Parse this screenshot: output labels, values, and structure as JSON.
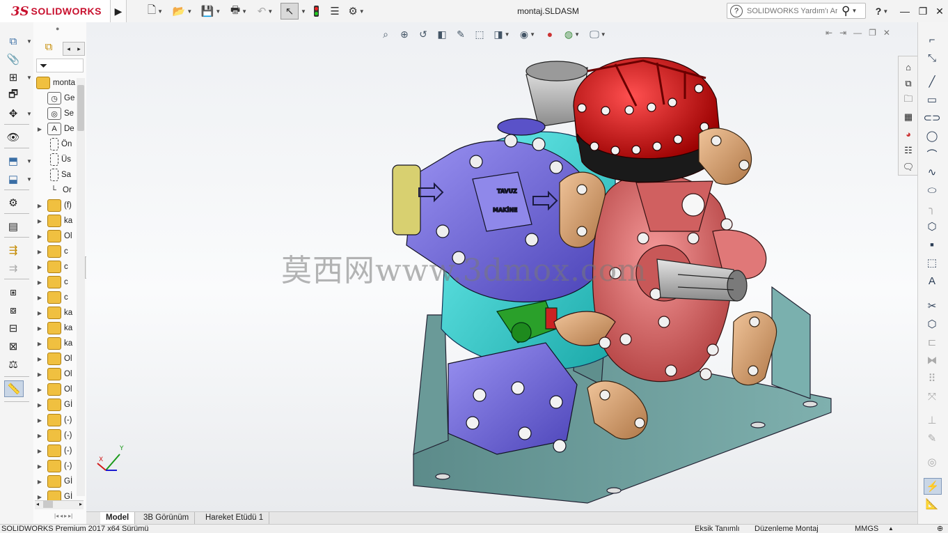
{
  "app": {
    "brand_ds": "3S",
    "brand_name": "SOLIDWORKS",
    "document_title": "montaj.SLDASM"
  },
  "help_search": {
    "placeholder": "SOLIDWORKS Yardım'ı Ara"
  },
  "feature_tree": {
    "root_label": "monta",
    "items": [
      {
        "label": "Ge",
        "icon": "history-icon",
        "expandable": false
      },
      {
        "label": "Se",
        "icon": "sensors-icon",
        "expandable": false
      },
      {
        "label": "De",
        "icon": "annotations-icon",
        "expandable": true
      },
      {
        "label": "Ön",
        "icon": "plane-icon",
        "expandable": false
      },
      {
        "label": "Üs",
        "icon": "plane-icon",
        "expandable": false
      },
      {
        "label": "Sa",
        "icon": "plane-icon",
        "expandable": false
      },
      {
        "label": "Or",
        "icon": "origin-icon",
        "expandable": false
      },
      {
        "label": "(f)",
        "icon": "part-icon",
        "expandable": true
      },
      {
        "label": "ka",
        "icon": "part-icon",
        "expandable": true
      },
      {
        "label": "Ol",
        "icon": "part-icon",
        "expandable": true
      },
      {
        "label": "c",
        "icon": "part-icon",
        "expandable": true
      },
      {
        "label": "c",
        "icon": "part-icon",
        "expandable": true
      },
      {
        "label": "c",
        "icon": "part-icon",
        "expandable": true
      },
      {
        "label": "c",
        "icon": "part-icon",
        "expandable": true
      },
      {
        "label": "ka",
        "icon": "part-icon",
        "expandable": true
      },
      {
        "label": "ka",
        "icon": "part-icon",
        "expandable": true
      },
      {
        "label": "ka",
        "icon": "part-icon",
        "expandable": true
      },
      {
        "label": "Ol",
        "icon": "part-icon",
        "expandable": true
      },
      {
        "label": "Ol",
        "icon": "part-icon",
        "expandable": true
      },
      {
        "label": "Ol",
        "icon": "part-icon",
        "expandable": true
      },
      {
        "label": "Gİ",
        "icon": "part-icon",
        "expandable": true
      },
      {
        "label": "(-)",
        "icon": "part-icon",
        "expandable": true
      },
      {
        "label": "(-)",
        "icon": "part-icon",
        "expandable": true
      },
      {
        "label": "(-)",
        "icon": "part-icon",
        "expandable": true
      },
      {
        "label": "(-)",
        "icon": "part-icon",
        "expandable": true
      },
      {
        "label": "Gİ",
        "icon": "part-icon",
        "expandable": true
      },
      {
        "label": "Gİ",
        "icon": "part-icon",
        "expandable": true
      }
    ]
  },
  "model_labels": {
    "line1": "TAVUZ",
    "line2": "MAKİNE"
  },
  "watermark": "莫西网www.3dmox.com",
  "triad": {
    "y": "Y",
    "x": "X"
  },
  "bottom_tabs": [
    {
      "label": "Model",
      "active": true
    },
    {
      "label": "3B Görünüm",
      "active": false
    },
    {
      "label": "Hareket Etüdü 1",
      "active": false
    }
  ],
  "status": {
    "product": "SOLIDWORKS Premium 2017 x64 Sürümü",
    "definition": "Eksik Tanımlı",
    "mode": "Düzenleme Montaj",
    "units": "MMGS"
  },
  "colors": {
    "brand_red": "#c8102e",
    "pump_body_blue": "#7b72e0",
    "housing_cyan": "#35d2d2",
    "front_cover_pink": "#de6f6f",
    "dome_red": "#d61818",
    "bracket_teal": "#6a9a98",
    "clamp_tan": "#d4a070"
  }
}
